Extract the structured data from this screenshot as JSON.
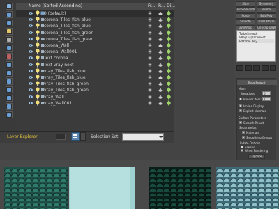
{
  "explorer": {
    "columns": [
      "Name (Sorted Ascending)",
      "Fr...",
      "R...",
      "Di..."
    ],
    "rows": [
      {
        "name": "0 (default)",
        "kind": "layer"
      },
      {
        "name": "corona_Tiles_fish_blue",
        "kind": "object"
      },
      {
        "name": "corona_Tiles_fish_blue",
        "kind": "object"
      },
      {
        "name": "corona_Tiles_fish_green",
        "kind": "object"
      },
      {
        "name": "corona_Tiles_fish_green",
        "kind": "object"
      },
      {
        "name": "corona_Wall",
        "kind": "object"
      },
      {
        "name": "corona_Wall001",
        "kind": "object"
      },
      {
        "name": "Text corona",
        "kind": "object"
      },
      {
        "name": "Text vray next",
        "kind": "object"
      },
      {
        "name": "vray_Tiles_fish_blue",
        "kind": "object"
      },
      {
        "name": "vray_Tiles_fish_blue",
        "kind": "object"
      },
      {
        "name": "vray_Tiles_fish_green",
        "kind": "object"
      },
      {
        "name": "vray_Tiles_fish_green",
        "kind": "object"
      },
      {
        "name": "vray_Wall",
        "kind": "object"
      },
      {
        "name": "vray_Wall001",
        "kind": "object"
      }
    ]
  },
  "bottom_bar": {
    "explorer_label": "Layer Explorer",
    "selection_set_label": "Selection Set:",
    "selection_set_value": ""
  },
  "command_panel": {
    "modifier_buttons": [
      "Slice",
      "Symmetry",
      "TurboSmooth",
      "Normal",
      "Noise",
      "Edit Poly",
      "Smooth",
      "UVW Xform",
      "UVW Map",
      "Unwrap UVW"
    ],
    "stack_items": [
      "TurboSmooth",
      "VRayDisplacement",
      "Editable Poly"
    ],
    "params": {
      "rollout_title": "TurboSmooth",
      "main_label": "Main",
      "iterations_label": "Iterations:",
      "iterations_value": "0",
      "render_iters_label": "Render Iters:",
      "render_iters_value": "2",
      "isoline_label": "Isoline Display",
      "explicit_label": "Explicit Normals",
      "surface_label": "Surface Parameters",
      "smooth_result_label": "Smooth Result",
      "separate_label": "Separate by:",
      "materials_label": "Materials",
      "smoothing_label": "Smoothing Groups",
      "update_label": "Update Options",
      "always_label": "Always",
      "when_rendering_label": "When Rendering",
      "manually_label": "Manually",
      "update_button": "Update"
    }
  },
  "colors": {
    "accent": "#e7c23b",
    "selected_button": "#5c86b2",
    "panel_bg": "#3b3b3b"
  },
  "swatches": [
    "teal-fish-scale",
    "light-blue",
    "dark-green-fish-scale",
    "blue-fish-scale"
  ]
}
